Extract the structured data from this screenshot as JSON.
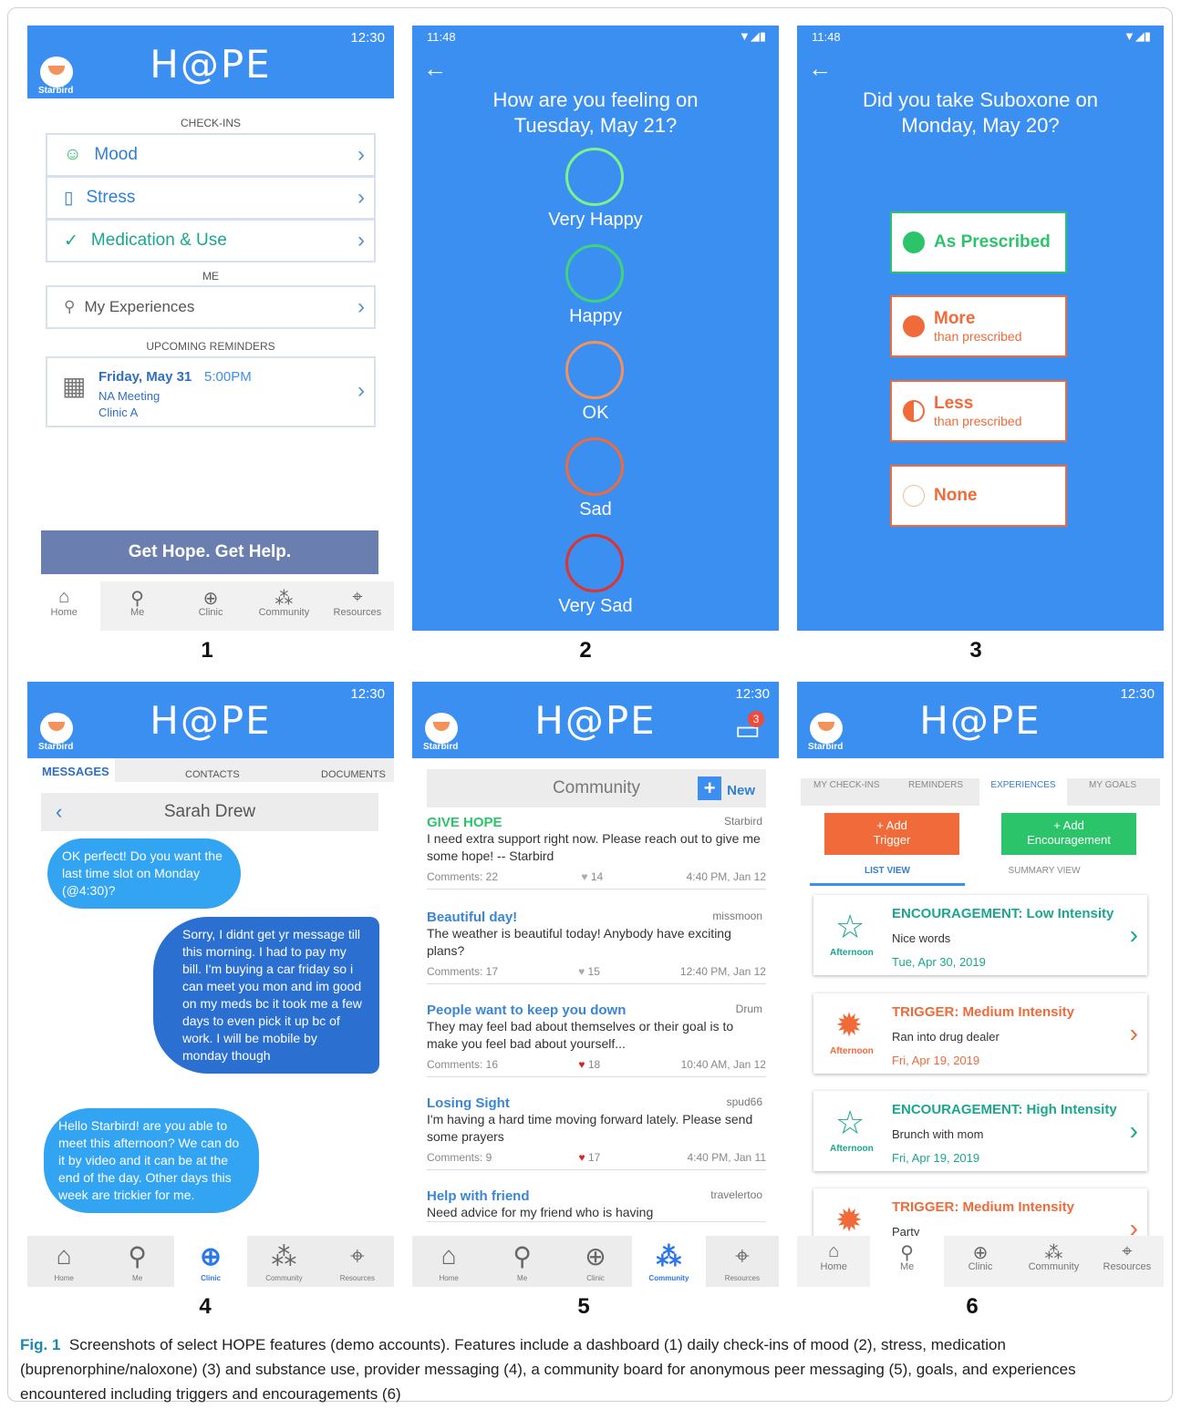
{
  "panel_numbers": [
    "1",
    "2",
    "3",
    "4",
    "5",
    "6"
  ],
  "logo": "H@PE",
  "status_time": "12:30",
  "status_time2": "11:48",
  "avatar_label": "Starbird",
  "p1": {
    "section_checkins": "CHECK-INS",
    "mood": "Mood",
    "stress": "Stress",
    "medication": "Medication & Use",
    "section_me": "ME",
    "experiences": "My Experiences",
    "section_reminders": "UPCOMING REMINDERS",
    "reminder_date": "Friday, May 31",
    "reminder_time": "5:00PM",
    "reminder_title": "NA Meeting",
    "reminder_place": "Clinic A",
    "help_button": "Get Hope. Get Help."
  },
  "nav": {
    "home": "Home",
    "me": "Me",
    "clinic": "Clinic",
    "community": "Community",
    "resources": "Resources"
  },
  "p2": {
    "question": "How are you feeling on Tuesday, May 21?",
    "very_happy": "Very Happy",
    "happy": "Happy",
    "ok": "OK",
    "sad": "Sad",
    "very_sad": "Very Sad"
  },
  "p3": {
    "question": "Did you take Suboxone on Monday, May 20?",
    "as_prescribed": "As Prescribed",
    "more": "More",
    "more_sub": "than prescribed",
    "less": "Less",
    "less_sub": "than prescribed",
    "none": "None"
  },
  "p4": {
    "tab_messages": "MESSAGES",
    "tab_contacts": "CONTACTS",
    "tab_documents": "DOCUMENTS",
    "contact": "Sarah Drew",
    "msg1": "OK perfect! Do you want the last time slot on Monday (@4:30)?",
    "msg2": "Sorry, I didnt get yr message till this morning. I had to pay my bill. I'm buying a car friday so i can meet you mon and im good on my meds bc it took me a few days to even pick it up bc of work. I will be mobile by monday though",
    "msg3": "Hello Starbird! are you able to meet this afternoon? We can do it by video and it can be at the end of the day. Other days this week are trickier for me."
  },
  "p5": {
    "title": "Community",
    "new": "New",
    "badge": "3",
    "posts": [
      {
        "title": "GIVE HOPE",
        "author": "Starbird",
        "body": "I need extra support right now. Please reach out to give me some hope! -- Starbird",
        "comments": "Comments: 22",
        "likes": "14",
        "time": "4:40 PM, Jan 12"
      },
      {
        "title": "Beautiful day!",
        "author": "missmoon",
        "body": "The weather is beautiful today! Anybody have exciting plans?",
        "comments": "Comments: 17",
        "likes": "15",
        "time": "12:40 PM, Jan 12"
      },
      {
        "title": "People want to keep you down",
        "author": "Drum",
        "body": "They may feel bad about themselves or their goal is to make you feel bad about yourself...",
        "comments": "Comments: 16",
        "likes": "18",
        "time": "10:40 AM, Jan 12"
      },
      {
        "title": "Losing Sight",
        "author": "spud66",
        "body": "I'm having a hard time moving forward lately. Please send some prayers",
        "comments": "Comments: 9",
        "likes": "17",
        "time": "4:40 PM, Jan 11"
      },
      {
        "title": "Help with friend",
        "author": "travelertoo",
        "body": "Need advice for my friend who is having",
        "comments": "",
        "likes": "",
        "time": ""
      }
    ]
  },
  "p6": {
    "tab_checkins": "MY CHECK-INS",
    "tab_reminders": "REMINDERS",
    "tab_experiences": "EXPERIENCES",
    "tab_goals": "MY GOALS",
    "add_trigger": "+ Add Trigger",
    "add_encouragement": "+ Add Encouragement",
    "list_view": "LIST VIEW",
    "summary_view": "SUMMARY VIEW",
    "items": [
      {
        "title": "ENCOURAGEMENT: Low Intensity",
        "body": "Nice words",
        "time": "Afternoon",
        "date": "Tue, Apr 30, 2019"
      },
      {
        "title": "TRIGGER: Medium Intensity",
        "body": "Ran into drug dealer",
        "time": "Afternoon",
        "date": "Fri, Apr 19, 2019"
      },
      {
        "title": "ENCOURAGEMENT: High Intensity",
        "body": "Brunch with mom",
        "time": "Afternoon",
        "date": "Fri, Apr 19, 2019"
      },
      {
        "title": "TRIGGER: Medium Intensity",
        "body": "Party",
        "time": "",
        "date": ""
      }
    ]
  },
  "caption": {
    "label": "Fig. 1",
    "text": "Screenshots of select HOPE features (demo accounts). Features include a dashboard (1) daily check-ins of mood (2), stress, medication (buprenorphine/naloxone) (3) and substance use, provider messaging (4), a community board for anonymous peer messaging (5), goals, and experiences encountered including triggers and encouragements (6)"
  },
  "colors": {
    "header": "#3b8ff0",
    "green": "#2bc46a",
    "orange": "#f06a3a",
    "teal": "#1aa78e"
  }
}
